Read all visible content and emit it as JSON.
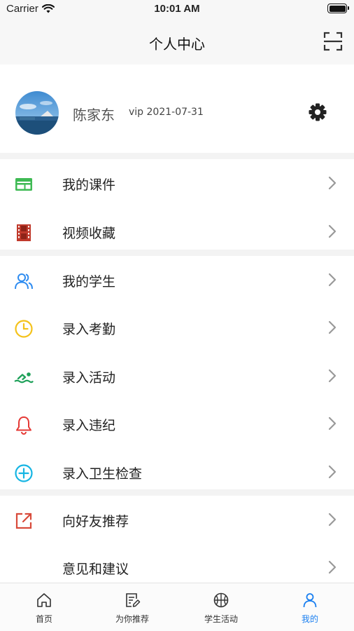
{
  "status_bar": {
    "carrier": "Carrier",
    "time": "10:01 AM"
  },
  "nav": {
    "title": "个人中心"
  },
  "profile": {
    "name": "陈家东",
    "vip": "vip 2021-07-31"
  },
  "colors": {
    "accent": "#1a7ff0",
    "courseware_icon": "#3fba54",
    "video_icon": "#c0392b",
    "students_icon": "#2f8cf0",
    "attendance_icon": "#f4c21b",
    "activity_icon": "#1fa15a",
    "violation_icon": "#e53935",
    "hygiene_icon": "#16b5e3",
    "share_icon": "#d84a3a"
  },
  "menu": [
    {
      "icon": "courseware-icon",
      "label": "我的课件"
    },
    {
      "icon": "film-icon",
      "label": "视频收藏"
    },
    {
      "icon": "users-icon",
      "label": "我的学生"
    },
    {
      "icon": "clock-icon",
      "label": "录入考勤"
    },
    {
      "icon": "swimmer-icon",
      "label": "录入活动"
    },
    {
      "icon": "bell-icon",
      "label": "录入违纪"
    },
    {
      "icon": "plus-circle-icon",
      "label": "录入卫生检查"
    },
    {
      "icon": "share-icon",
      "label": "向好友推荐"
    },
    {
      "icon": "",
      "label": "意见和建议"
    }
  ],
  "tabs": [
    {
      "icon": "home-icon",
      "label": "首页",
      "active": false
    },
    {
      "icon": "edit-icon",
      "label": "为你推荐",
      "active": false
    },
    {
      "icon": "basketball-icon",
      "label": "学生活动",
      "active": false
    },
    {
      "icon": "user-icon",
      "label": "我的",
      "active": true
    }
  ]
}
